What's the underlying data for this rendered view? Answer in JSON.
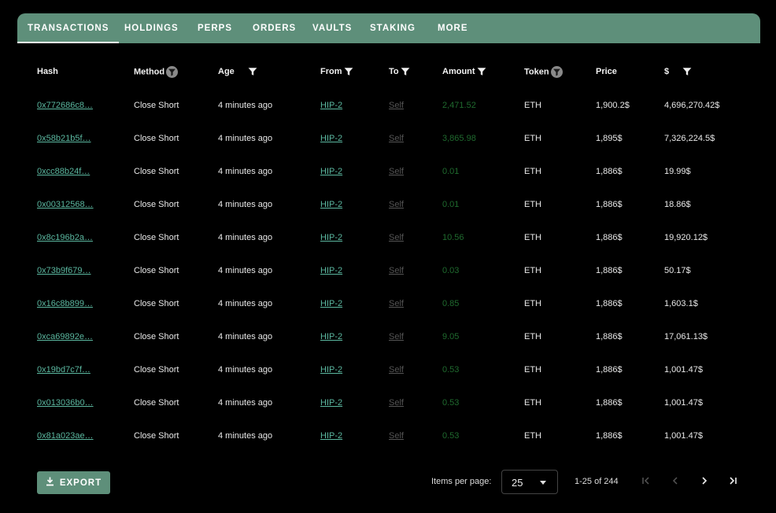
{
  "tabs": [
    {
      "label": "TRANSACTIONS",
      "active": true
    },
    {
      "label": "HOLDINGS"
    },
    {
      "label": "PERPS"
    },
    {
      "label": "ORDERS"
    },
    {
      "label": "VAULTS"
    },
    {
      "label": "STAKING"
    },
    {
      "label": "MORE"
    }
  ],
  "columns": {
    "hash": "Hash",
    "method": "Method",
    "age": "Age",
    "from": "From",
    "to": "To",
    "amount": "Amount",
    "token": "Token",
    "price": "Price",
    "usd": "$"
  },
  "rows": [
    {
      "hash": "0x772686c8…",
      "method": "Close Short",
      "age": "4 minutes ago",
      "from": "HIP-2",
      "to": "Self",
      "amount": "2,471.52",
      "token": "ETH",
      "price": "1,900.2$",
      "usd": "4,696,270.42$"
    },
    {
      "hash": "0x58b21b5f…",
      "method": "Close Short",
      "age": "4 minutes ago",
      "from": "HIP-2",
      "to": "Self",
      "amount": "3,865.98",
      "token": "ETH",
      "price": "1,895$",
      "usd": "7,326,224.5$"
    },
    {
      "hash": "0xcc88b24f…",
      "method": "Close Short",
      "age": "4 minutes ago",
      "from": "HIP-2",
      "to": "Self",
      "amount": "0.01",
      "token": "ETH",
      "price": "1,886$",
      "usd": "19.99$"
    },
    {
      "hash": "0x00312568…",
      "method": "Close Short",
      "age": "4 minutes ago",
      "from": "HIP-2",
      "to": "Self",
      "amount": "0.01",
      "token": "ETH",
      "price": "1,886$",
      "usd": "18.86$"
    },
    {
      "hash": "0x8c196b2a…",
      "method": "Close Short",
      "age": "4 minutes ago",
      "from": "HIP-2",
      "to": "Self",
      "amount": "10.56",
      "token": "ETH",
      "price": "1,886$",
      "usd": "19,920.12$"
    },
    {
      "hash": "0x73b9f679…",
      "method": "Close Short",
      "age": "4 minutes ago",
      "from": "HIP-2",
      "to": "Self",
      "amount": "0.03",
      "token": "ETH",
      "price": "1,886$",
      "usd": "50.17$"
    },
    {
      "hash": "0x16c8b899…",
      "method": "Close Short",
      "age": "4 minutes ago",
      "from": "HIP-2",
      "to": "Self",
      "amount": "0.85",
      "token": "ETH",
      "price": "1,886$",
      "usd": "1,603.1$"
    },
    {
      "hash": "0xca69892e…",
      "method": "Close Short",
      "age": "4 minutes ago",
      "from": "HIP-2",
      "to": "Self",
      "amount": "9.05",
      "token": "ETH",
      "price": "1,886$",
      "usd": "17,061.13$"
    },
    {
      "hash": "0x19bd7c7f…",
      "method": "Close Short",
      "age": "4 minutes ago",
      "from": "HIP-2",
      "to": "Self",
      "amount": "0.53",
      "token": "ETH",
      "price": "1,886$",
      "usd": "1,001.47$"
    },
    {
      "hash": "0x013036b0…",
      "method": "Close Short",
      "age": "4 minutes ago",
      "from": "HIP-2",
      "to": "Self",
      "amount": "0.53",
      "token": "ETH",
      "price": "1,886$",
      "usd": "1,001.47$"
    },
    {
      "hash": "0x81a023ae…",
      "method": "Close Short",
      "age": "4 minutes ago",
      "from": "HIP-2",
      "to": "Self",
      "amount": "0.53",
      "token": "ETH",
      "price": "1,886$",
      "usd": "1,001.47$"
    }
  ],
  "footer": {
    "export_label": "EXPORT",
    "items_per_page_label": "Items per page:",
    "items_per_page_value": "25",
    "range_label": "1-25 of 244"
  },
  "colors": {
    "accent": "#5e8f7a",
    "link": "#5bb8a0",
    "amount": "#1f6a2e"
  }
}
